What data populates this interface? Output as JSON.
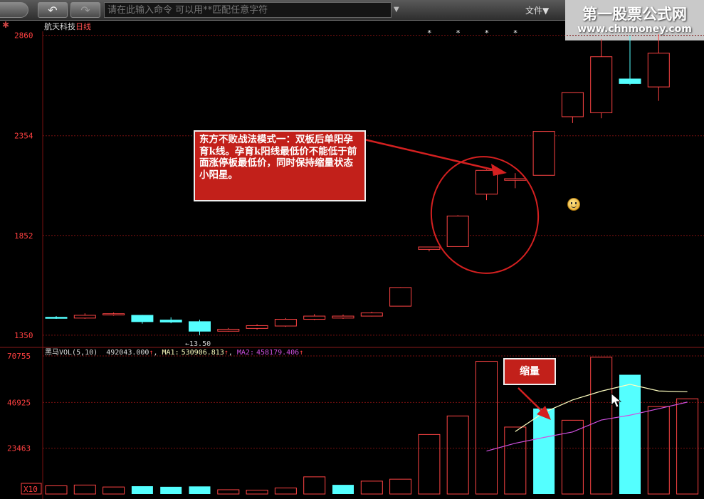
{
  "toolbar": {
    "back_icon": "back-arrow-icon",
    "forward_icon": "forward-arrow-icon",
    "command_placeholder": "请在此输入命令  可以用**匹配任意字符",
    "file_menu": "文件▼"
  },
  "watermark": {
    "line1": "第一股票公式网",
    "line2": "www.chnmoney.com"
  },
  "stock": {
    "name": "航天科技",
    "period": "日线"
  },
  "price_axis": {
    "ticks": [
      2860,
      2354,
      1852,
      1350
    ]
  },
  "low_marker": "←13.50",
  "star_marker": "*",
  "annotation_main": "东方不败战法模式一：双板后单阳孕育k线。孕育k阳线最低价不能低于前面涨停板最低价，同时保持缩量状态小阳星。",
  "annotation_volume": "缩量",
  "volume": {
    "prefix": "黑马VOL(5,10)",
    "vol_value": "492043.000",
    "ma1_label": "MA1:",
    "ma1_value": "530906.813",
    "ma2_label": "MA2:",
    "ma2_value": "458179.406",
    "up_arrow": "↑",
    "ticks": [
      70755,
      46925,
      23463
    ],
    "unit": "X10"
  },
  "colors": {
    "up": "#ff4444",
    "down": "#54ffff",
    "ma1": "#ffffc0",
    "ma2": "#d050e0",
    "grid": "#7a1010",
    "axis_text": "#ff4040",
    "annot_bg": "#c2201a"
  },
  "chart_data": [
    {
      "type": "candlestick",
      "title": "航天科技 日线",
      "ylim": [
        1310,
        2880
      ],
      "yticks": [
        2860,
        2354,
        1852,
        1350
      ],
      "candles": [
        {
          "open": 1440,
          "close": 1436,
          "high": 1446,
          "low": 1432
        },
        {
          "open": 1436,
          "close": 1450,
          "high": 1460,
          "low": 1432
        },
        {
          "open": 1452,
          "close": 1458,
          "high": 1464,
          "low": 1448
        },
        {
          "open": 1450,
          "close": 1418,
          "high": 1452,
          "low": 1408
        },
        {
          "open": 1426,
          "close": 1416,
          "high": 1440,
          "low": 1410
        },
        {
          "open": 1418,
          "close": 1370,
          "high": 1428,
          "low": 1350
        },
        {
          "open": 1370,
          "close": 1380,
          "high": 1386,
          "low": 1368
        },
        {
          "open": 1384,
          "close": 1398,
          "high": 1405,
          "low": 1378
        },
        {
          "open": 1396,
          "close": 1430,
          "high": 1436,
          "low": 1392
        },
        {
          "open": 1430,
          "close": 1446,
          "high": 1456,
          "low": 1426
        },
        {
          "open": 1436,
          "close": 1446,
          "high": 1454,
          "low": 1432
        },
        {
          "open": 1446,
          "close": 1462,
          "high": 1468,
          "low": 1444
        },
        {
          "open": 1496,
          "close": 1590,
          "high": 1592,
          "low": 1496
        },
        {
          "open": 1782,
          "close": 1794,
          "high": 1794,
          "low": 1772
        },
        {
          "open": 1796,
          "close": 1950,
          "high": 1954,
          "low": 1796
        },
        {
          "open": 2060,
          "close": 2180,
          "high": 2184,
          "low": 2030
        },
        {
          "open": 2130,
          "close": 2138,
          "high": 2166,
          "low": 2090
        },
        {
          "open": 2155,
          "close": 2376,
          "high": 2376,
          "low": 2155
        },
        {
          "open": 2450,
          "close": 2572,
          "high": 2572,
          "low": 2418
        },
        {
          "open": 2470,
          "close": 2752,
          "high": 2840,
          "low": 2442
        },
        {
          "open": 2640,
          "close": 2617,
          "high": 2860,
          "low": 2610
        },
        {
          "open": 2600,
          "close": 2770,
          "high": 2865,
          "low": 2530
        }
      ],
      "markers": [
        {
          "index": 5,
          "label": "←13.50"
        }
      ],
      "star_indices": [
        13,
        14,
        15,
        16,
        19
      ]
    },
    {
      "type": "bar",
      "title": "黑马VOL(5,10)",
      "ylim": [
        0,
        70755
      ],
      "yticks": [
        70755,
        46925,
        23463
      ],
      "values": [
        4200,
        4600,
        3600,
        4000,
        3700,
        3900,
        2200,
        2000,
        3100,
        8800,
        4700,
        6600,
        7600,
        30500,
        40000,
        68000,
        34300,
        43800,
        37800,
        70100,
        61100,
        44800,
        48800
      ],
      "down_indices": [
        3,
        4,
        5,
        10,
        17,
        20
      ],
      "series": [
        {
          "name": "MA1",
          "x": [
            16,
            17,
            18,
            19,
            20,
            21,
            22
          ],
          "values": [
            32000,
            41800,
            48200,
            52700,
            56200,
            52800,
            52400
          ]
        },
        {
          "name": "MA2",
          "x": [
            15,
            16,
            17,
            18,
            19,
            20,
            21,
            22
          ],
          "values": [
            22000,
            26000,
            29000,
            31800,
            37900,
            40400,
            43700,
            47100
          ]
        }
      ]
    }
  ]
}
